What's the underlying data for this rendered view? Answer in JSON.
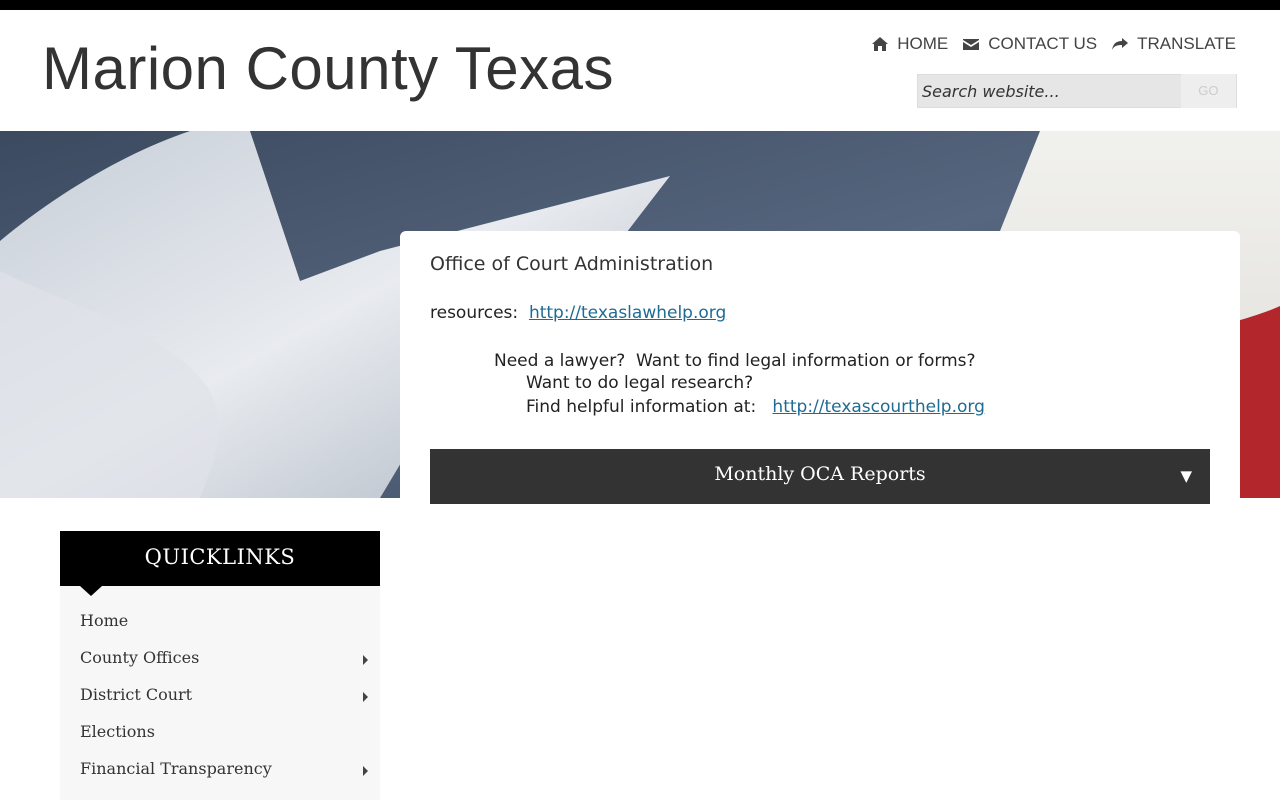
{
  "site": {
    "title": "Marion County Texas"
  },
  "topnav": {
    "home": "HOME",
    "contact": "CONTACT US",
    "translate": "TRANSLATE"
  },
  "search": {
    "placeholder": "Search website...",
    "go": "GO"
  },
  "panel": {
    "heading": "Office of Court Administration",
    "resources_label": "resources:",
    "resources_link": "http://texaslawhelp.org",
    "line1": "Need a lawyer?  Want to find legal information or forms?",
    "line2": "Want to do legal research?",
    "line3_label": "Find helpful information at:",
    "line3_link": "http://texascourthelp.org",
    "accordion": {
      "label": "Monthly OCA Reports",
      "arrow": "▼"
    }
  },
  "quicklinks": {
    "title": "QUICKLINKS",
    "items": [
      {
        "label": "Home",
        "has_submenu": false
      },
      {
        "label": "County Offices",
        "has_submenu": true
      },
      {
        "label": "District Court",
        "has_submenu": true
      },
      {
        "label": "Elections",
        "has_submenu": false
      },
      {
        "label": "Financial Transparency",
        "has_submenu": true
      }
    ]
  },
  "colors": {
    "link": "#1f6b93",
    "accordion_bg": "#333333",
    "quick_head_bg": "#000000",
    "quick_bg": "#f7f7f7"
  }
}
